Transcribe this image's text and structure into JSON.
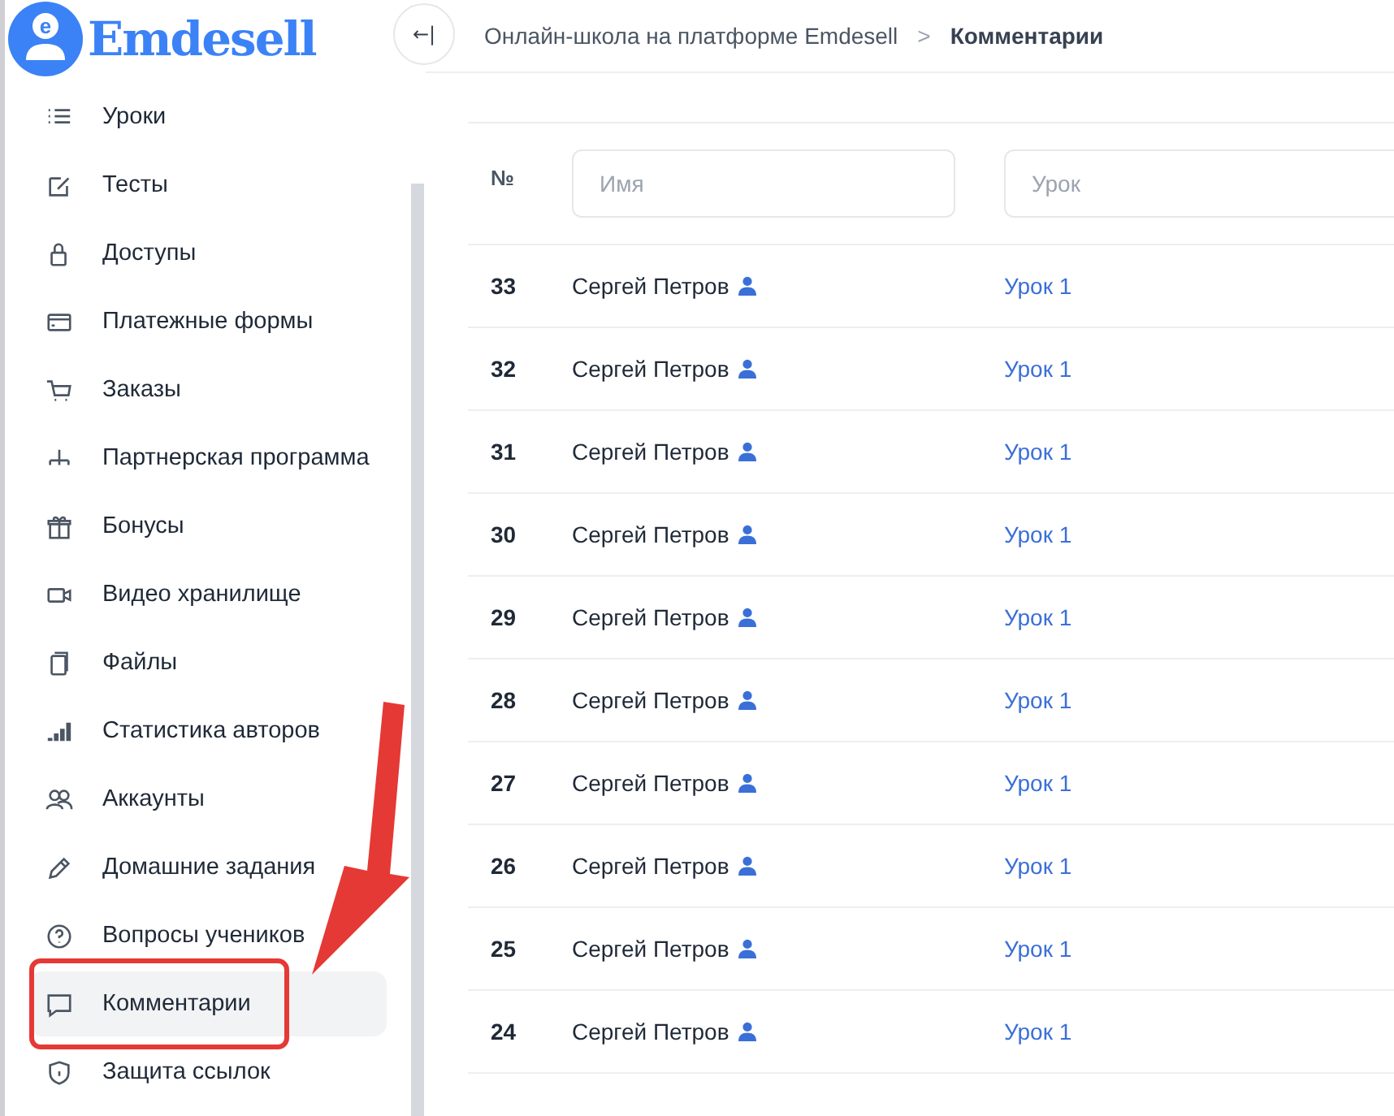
{
  "logo": {
    "text": "Emdesell",
    "icon_letter": "e"
  },
  "sidebar": {
    "items": [
      {
        "label": "Уроки",
        "selected": false
      },
      {
        "label": "Тесты",
        "selected": false
      },
      {
        "label": "Доступы",
        "selected": false
      },
      {
        "label": "Платежные формы",
        "selected": false
      },
      {
        "label": "Заказы",
        "selected": false
      },
      {
        "label": "Партнерская программа",
        "selected": false
      },
      {
        "label": "Бонусы",
        "selected": false
      },
      {
        "label": "Видео хранилище",
        "selected": false
      },
      {
        "label": "Файлы",
        "selected": false
      },
      {
        "label": "Статистика авторов",
        "selected": false
      },
      {
        "label": "Аккаунты",
        "selected": false
      },
      {
        "label": "Домашние задания",
        "selected": false
      },
      {
        "label": "Вопросы учеников",
        "selected": false
      },
      {
        "label": "Комментарии",
        "selected": true
      },
      {
        "label": "Защита ссылок",
        "selected": false
      }
    ]
  },
  "breadcrumb": {
    "toggle": "←|",
    "parent": "Онлайн-школа на платформе Emdesell",
    "separator": ">",
    "current": "Комментарии"
  },
  "table": {
    "columns": [
      {
        "kind": "label",
        "label": "№"
      },
      {
        "kind": "filter",
        "placeholder": "Имя"
      },
      {
        "kind": "filter",
        "placeholder": "Урок"
      }
    ],
    "rows": [
      {
        "number": "33",
        "name": "Сергей Петров",
        "lesson": "Урок 1"
      },
      {
        "number": "32",
        "name": "Сергей Петров",
        "lesson": "Урок 1"
      },
      {
        "number": "31",
        "name": "Сергей Петров",
        "lesson": "Урок 1"
      },
      {
        "number": "30",
        "name": "Сергей Петров",
        "lesson": "Урок 1"
      },
      {
        "number": "29",
        "name": "Сергей Петров",
        "lesson": "Урок 1"
      },
      {
        "number": "28",
        "name": "Сергей Петров",
        "lesson": "Урок 1"
      },
      {
        "number": "27",
        "name": "Сергей Петров",
        "lesson": "Урок 1"
      },
      {
        "number": "26",
        "name": "Сергей Петров",
        "lesson": "Урок 1"
      },
      {
        "number": "25",
        "name": "Сергей Петров",
        "lesson": "Урок 1"
      },
      {
        "number": "24",
        "name": "Сергей Петров",
        "lesson": "Урок 1"
      }
    ]
  }
}
